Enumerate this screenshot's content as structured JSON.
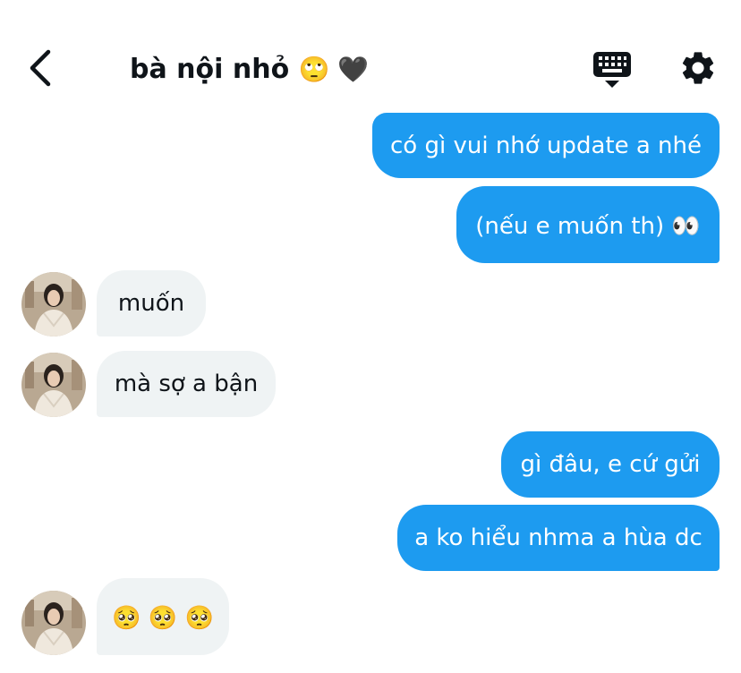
{
  "header": {
    "title": "bà nội nhỏ",
    "title_emojis": "🙄 🖤",
    "back_icon": "chevron-left-icon",
    "keyboard_icon": "keyboard-icon",
    "settings_icon": "gear-icon"
  },
  "colors": {
    "sent_bubble": "#1d9bf0",
    "received_bubble": "#eff3f4",
    "text": "#0f1419"
  },
  "messages": [
    {
      "from": "me",
      "text": "có gì vui nhớ update a nhé"
    },
    {
      "from": "me",
      "text": "(nếu e muốn th) 👀"
    },
    {
      "from": "them",
      "text": "muốn"
    },
    {
      "from": "them",
      "text": "mà sợ a bận"
    },
    {
      "from": "me",
      "text": "gì đâu, e cứ gửi"
    },
    {
      "from": "me",
      "text": "a ko hiểu nhma a hùa dc"
    },
    {
      "from": "them",
      "text": "🥺 🥺 🥺"
    }
  ]
}
